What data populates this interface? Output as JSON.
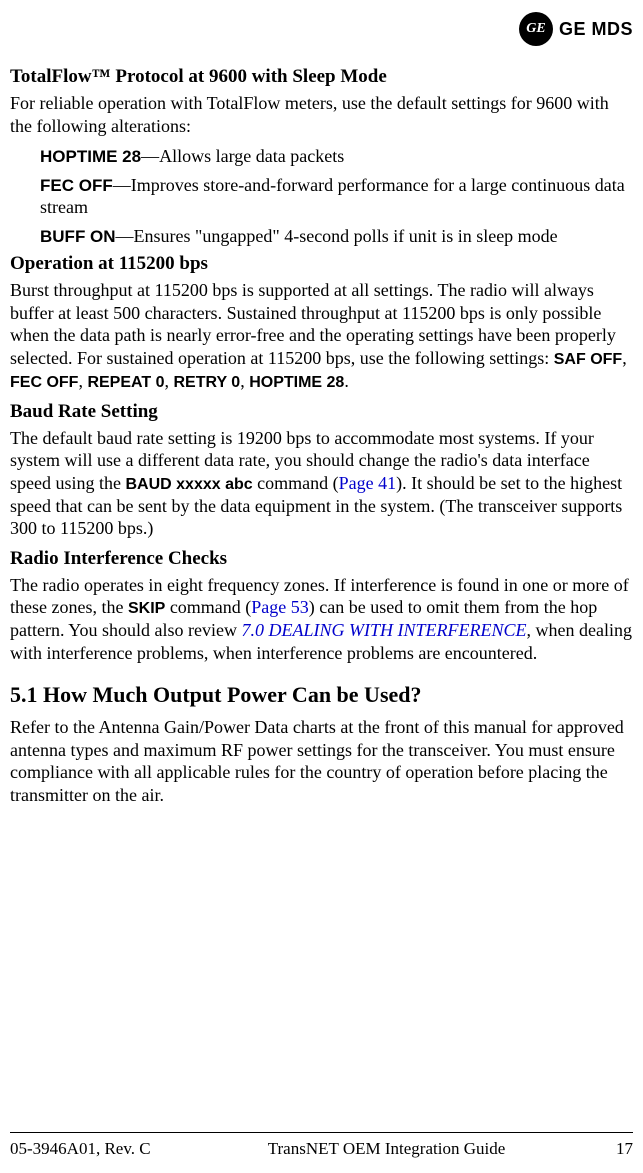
{
  "header": {
    "brand_script": "GE",
    "brand_text": "GE MDS"
  },
  "section1": {
    "title": "TotalFlow™ Protocol at 9600 with Sleep Mode",
    "intro": "For reliable operation with TotalFlow meters, use the default settings for 9600 with the following alterations:",
    "items": [
      {
        "cmd": "HOPTIME 28",
        "desc": "—Allows large data packets"
      },
      {
        "cmd": "FEC OFF",
        "desc": "—Improves store-and-forward performance for a large continuous data stream"
      },
      {
        "cmd": "BUFF ON",
        "desc": "—Ensures \"ungapped\" 4-second polls if unit is in sleep mode"
      }
    ]
  },
  "section2": {
    "title": "Operation at 115200 bps",
    "body_prefix": "Burst throughput at 115200 bps is supported at all settings. The radio will always buffer at least 500 characters. Sustained throughput at 115200 bps is only possible when the data path is nearly error-free and the operating settings have been properly selected. For sustained operation at 115200 bps, use the following settings: ",
    "cmds": [
      "SAF OFF",
      "FEC OFF",
      "REPEAT 0",
      "RETRY 0",
      "HOPTIME 28"
    ],
    "sep": ", ",
    "end": "."
  },
  "section3": {
    "title": "Baud Rate Setting",
    "body_p1": "The default baud rate setting is 19200 bps to accommodate most systems. If your system will use a different data rate, you should change the radio's data interface speed using the ",
    "cmd": "BAUD xxxxx abc",
    "body_p2": " command (",
    "link": "Page 41",
    "body_p3": "). It should be set to the highest speed that can be sent by the data equipment in the system. (The transceiver supports 300 to 115200 bps.)"
  },
  "section4": {
    "title": "Radio Interference Checks",
    "body_p1": "The radio operates in eight frequency zones. If interference is found in one or more of these zones, the ",
    "cmd": "SKIP",
    "body_p2": " command (",
    "link": "Page 53",
    "body_p3": ") can be used to omit them from the hop pattern. You should also review ",
    "ref": "7.0 DEALING WITH INTERFERENCE",
    "body_p4": ", when dealing with interference problems, when interference problems are encountered."
  },
  "section5": {
    "title": "5.1   How Much Output Power Can be Used?",
    "body": "Refer to the Antenna Gain/Power Data charts at the front of this manual for approved antenna types and maximum RF power settings for the transceiver. You must ensure compliance with all applicable rules for the country of operation before placing the transmitter on the air."
  },
  "footer": {
    "left": "05-3946A01, Rev. C",
    "center": "TransNET OEM Integration Guide",
    "right": "17"
  }
}
